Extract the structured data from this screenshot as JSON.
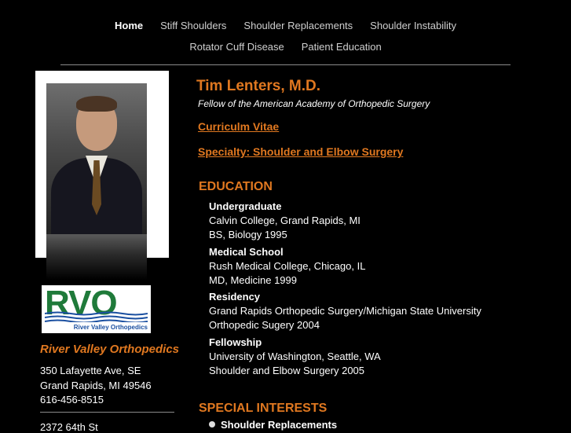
{
  "nav": {
    "row1": [
      "Home",
      "Stiff Shoulders",
      "Shoulder Replacements",
      "Shoulder Instability"
    ],
    "row2": [
      "Rotator Cuff Disease",
      "Patient Education"
    ]
  },
  "logo": {
    "letters": "RVO",
    "tagline": "River Valley Orthopedics"
  },
  "sidebar": {
    "org_name": "River Valley Orthopedics",
    "address1": "350 Lafayette Ave, SE",
    "address2": "Grand Rapids, MI  49546",
    "phone": "616-456-8515",
    "address3_partial": "2372 64th St"
  },
  "main": {
    "name": "Tim Lenters, M.D.",
    "fellowship": "Fellow of the American Academy of Orthopedic Surgery",
    "cv_link": "Curriculm Vitae",
    "specialty_link": "Specialty:  Shoulder and Elbow Surgery",
    "education_heading": "EDUCATION",
    "education": [
      {
        "title": "Undergraduate",
        "lines": [
          "Calvin College, Grand Rapids, MI",
          "BS, Biology 1995"
        ]
      },
      {
        "title": "Medical School",
        "lines": [
          "Rush Medical College, Chicago, IL",
          "MD, Medicine 1999"
        ]
      },
      {
        "title": "Residency",
        "lines": [
          "Grand Rapids Orthopedic Surgery/Michigan State University",
          "Orthopedic Sugery 2004"
        ]
      },
      {
        "title": "Fellowship",
        "lines": [
          "University of Washington, Seattle, WA",
          "Shoulder and Elbow Surgery 2005"
        ]
      }
    ],
    "interests_heading": "SPECIAL INTERESTS",
    "interests": [
      "Shoulder Replacements"
    ]
  }
}
